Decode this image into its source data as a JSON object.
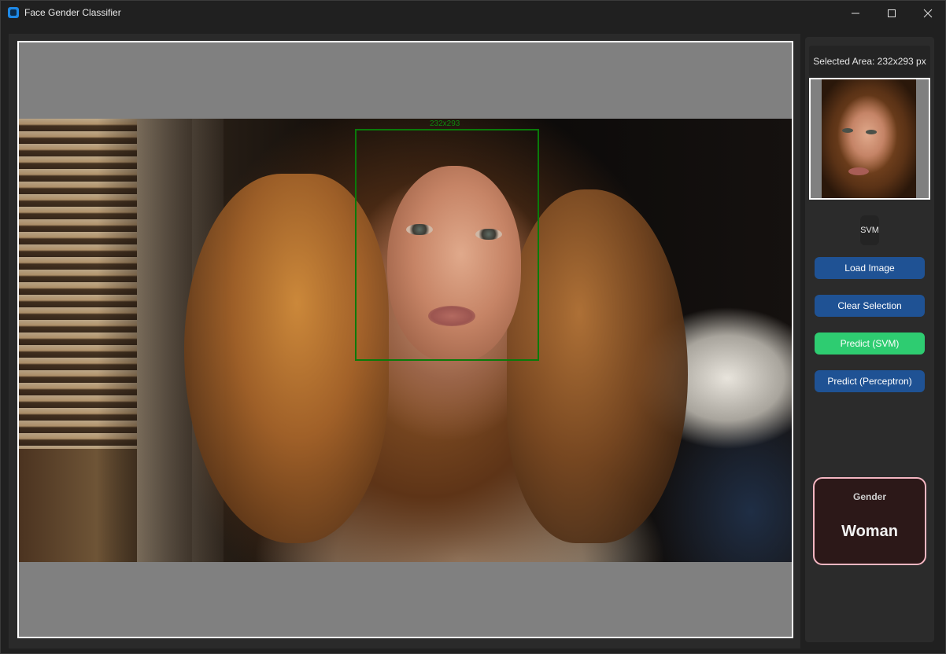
{
  "window": {
    "title": "Face Gender Classifier"
  },
  "canvas": {
    "selection_label": "232x293"
  },
  "sidebar": {
    "selected_area": "Selected Area: 232x293 px",
    "model": "SVM",
    "buttons": {
      "load": "Load Image",
      "clear": "Clear Selection",
      "predict_svm": "Predict (SVM)",
      "predict_perceptron": "Predict (Perceptron)"
    },
    "result": {
      "label": "Gender",
      "value": "Woman"
    }
  },
  "icons": {
    "app": "app-icon",
    "minimize": "minimize-icon",
    "maximize": "maximize-icon",
    "close": "close-icon"
  },
  "colors": {
    "accent_blue": "#1f5294",
    "active_green": "#2ecc71",
    "selection_green": "#0a7a0a",
    "result_border": "#f4b6c2"
  }
}
